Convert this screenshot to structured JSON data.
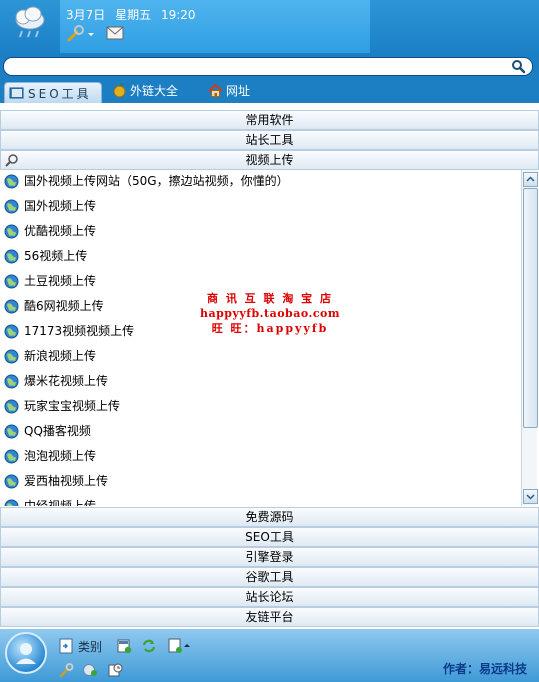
{
  "header": {
    "date": "3月7日",
    "weekday": "星期五",
    "time": "19:20",
    "weather_icon": "cloud-rain-icon",
    "settings_icon": "wrench-icon",
    "mail_icon": "mail-icon"
  },
  "search": {
    "value": "",
    "placeholder": ""
  },
  "tabs": [
    {
      "label": "SEO工具",
      "icon": "book-icon",
      "active": true
    },
    {
      "label": "外链大全",
      "icon": "apple-icon",
      "active": false
    },
    {
      "label": "网址",
      "icon": "home-icon",
      "active": false
    }
  ],
  "categories_top": [
    "常用软件",
    "站长工具",
    "视频上传"
  ],
  "list_items": [
    "国外视频上传网站（50G，擦边站视频，你懂的）",
    "国外视频上传",
    "优酷视频上传",
    "56视频上传",
    "土豆视频上传",
    "酷6网视频上传",
    "17173视频视频上传",
    "新浪视频上传",
    "爆米花视频上传",
    "玩家宝宝视频上传",
    "QQ播客视频",
    "泡泡视频上传",
    "爱西柚视频上传",
    "中经视频上传"
  ],
  "watermark": {
    "line1": "商 讯 互 联 淘 宝 店",
    "line2": "happyyfb.taobao.com",
    "line3": "旺 旺：happyyfb"
  },
  "categories_bottom": [
    "免费源码",
    "SEO工具",
    "引擎登录",
    "谷歌工具",
    "站长论坛",
    "友链平台"
  ],
  "footer": {
    "category_label": "类别",
    "author": "作者：易远科技"
  },
  "colors": {
    "accent": "#1c7fc4",
    "watermark": "#dd0000"
  }
}
